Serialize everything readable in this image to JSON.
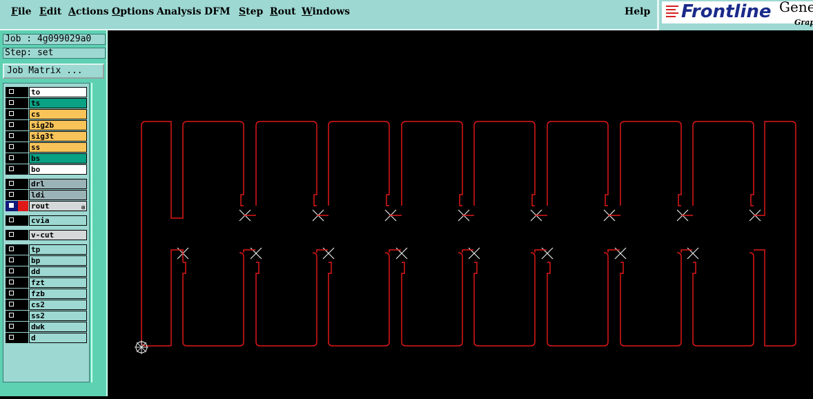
{
  "menubar": {
    "file": "File",
    "edit": "Edit",
    "actions": "Actions",
    "options": "Options",
    "analysis": "Analysis",
    "dfm": "DFM",
    "step": "Step",
    "rout": "Rout",
    "windows": "Windows",
    "help": "Help"
  },
  "brand": {
    "name": "Frontline",
    "product": "Gene",
    "sub": "Grap"
  },
  "job": {
    "job_label": "Job : 4g099029a0",
    "step_label": "Step: set",
    "matrix_button": "Job Matrix ..."
  },
  "layers": [
    {
      "name": "to",
      "color": "#ffffff"
    },
    {
      "name": "ts",
      "color": "#0aa184"
    },
    {
      "name": "cs",
      "color": "#f8c45a"
    },
    {
      "name": "sig2b",
      "color": "#f8c45a"
    },
    {
      "name": "sig3t",
      "color": "#f8c45a"
    },
    {
      "name": "ss",
      "color": "#f8c45a"
    },
    {
      "name": "bs",
      "color": "#0aa184"
    },
    {
      "name": "bo",
      "color": "#ffffff"
    },
    {
      "name": "drl",
      "color": "#9ab3b7"
    },
    {
      "name": "ldi",
      "color": "#9ab3b7"
    },
    {
      "name": "rout",
      "color": "#d4d8d8"
    },
    {
      "name": "cvia",
      "color": "#9dd8d2"
    },
    {
      "name": "v-cut",
      "color": "#d4d8d8"
    },
    {
      "name": "tp",
      "color": "#9dd8d2"
    },
    {
      "name": "bp",
      "color": "#9dd8d2"
    },
    {
      "name": "dd",
      "color": "#9dd8d2"
    },
    {
      "name": "fzt",
      "color": "#9dd8d2"
    },
    {
      "name": "fzb",
      "color": "#9dd8d2"
    },
    {
      "name": "cs2",
      "color": "#9dd8d2"
    },
    {
      "name": "ss2",
      "color": "#9dd8d2"
    },
    {
      "name": "dwk",
      "color": "#9dd8d2"
    },
    {
      "name": "d",
      "color": "#9dd8d2"
    }
  ],
  "active_layer": "rout",
  "colors": {
    "rout_line": "#e01818",
    "menu_bg": "#9dd8d2",
    "panel_bg": "#5ed1b3",
    "canvas_bg": "#000000"
  }
}
